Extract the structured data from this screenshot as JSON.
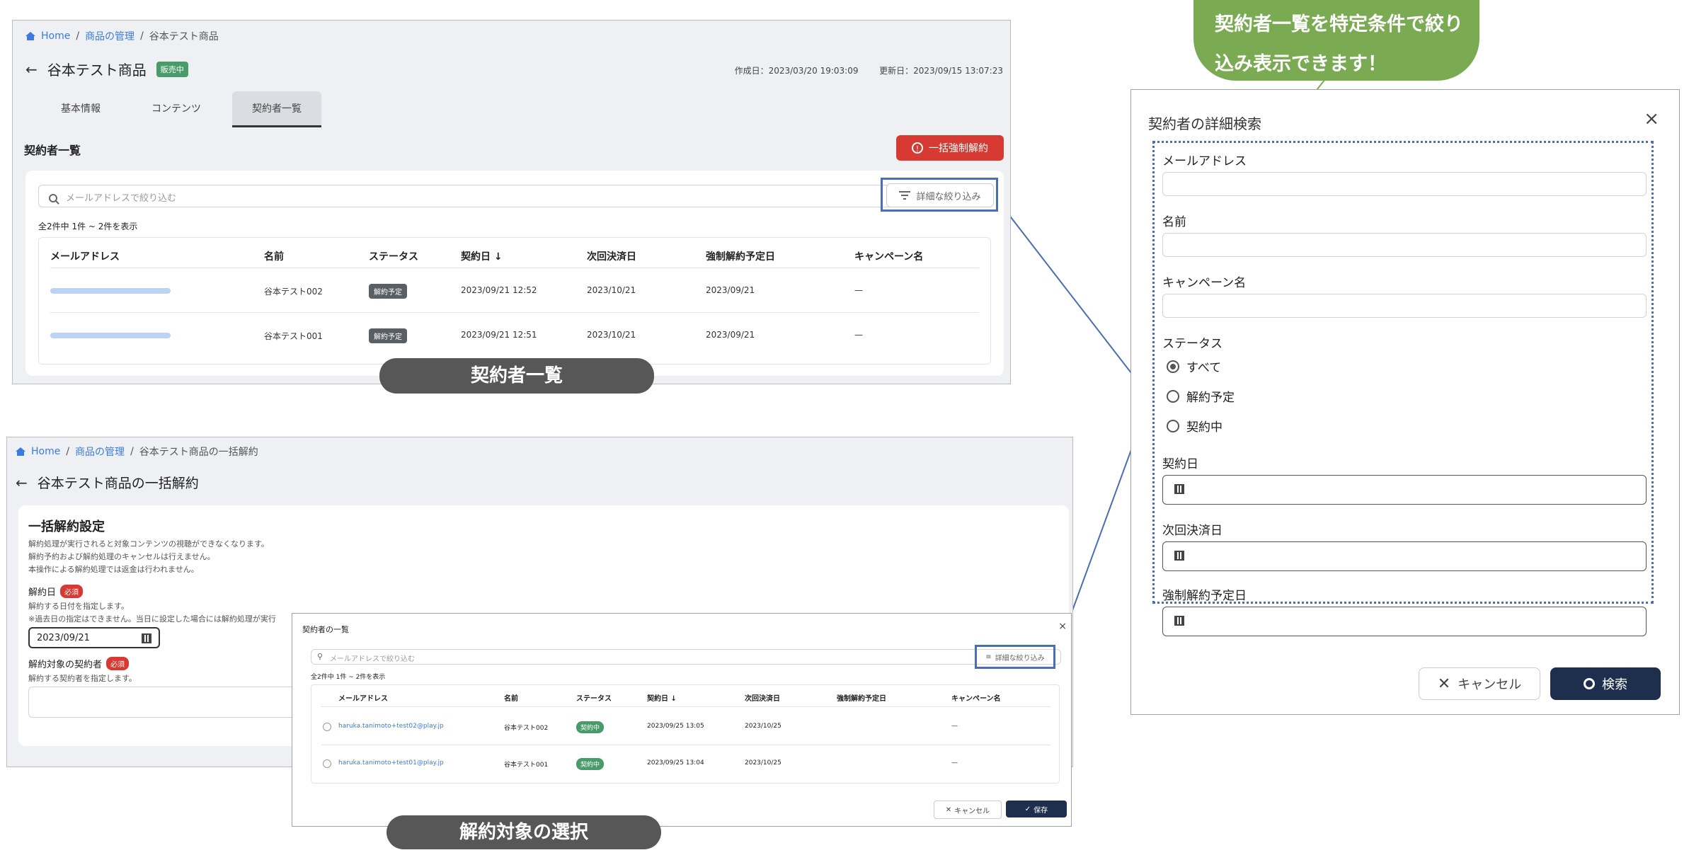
{
  "callout": {
    "line1": "契約者一覧を特定条件で絞り",
    "line2": "込み表示できます！"
  },
  "captions": {
    "top": "契約者一覧",
    "bottom": "解約対象の選択"
  },
  "top_screen": {
    "breadcrumb": {
      "home": "Home",
      "sep": "/",
      "level1": "商品の管理",
      "current": "谷本テスト商品"
    },
    "title": "谷本テスト商品",
    "status_badge": "販売中",
    "created": "作成日：2023/03/20 19:03:09",
    "updated": "更新日：2023/09/15 13:07:23",
    "tabs": [
      "基本情報",
      "コンテンツ",
      "契約者一覧"
    ],
    "section_title": "契約者一覧",
    "bulk_button": "一括強制解約",
    "search_placeholder": "メールアドレスで絞り込む",
    "filter_button": "詳細な絞り込み",
    "count_text": "全2件中 1件 ~ 2件を表示",
    "columns": [
      "メールアドレス",
      "名前",
      "ステータス",
      "契約日 ↓",
      "次回決済日",
      "強制解約予定日",
      "キャンペーン名"
    ],
    "rows": [
      {
        "name": "谷本テスト002",
        "status": "解約予定",
        "contract": "2023/09/21 12:52",
        "next": "2023/10/21",
        "forced": "2023/09/21",
        "campaign": "—"
      },
      {
        "name": "谷本テスト001",
        "status": "解約予定",
        "contract": "2023/09/21 12:51",
        "next": "2023/10/21",
        "forced": "2023/09/21",
        "campaign": "—"
      }
    ]
  },
  "bottom_screen": {
    "breadcrumb": {
      "home": "Home",
      "sep": "/",
      "level1": "商品の管理",
      "current": "谷本テスト商品の一括解約"
    },
    "title": "谷本テスト商品の一括解約",
    "section_title": "一括解約設定",
    "desc": [
      "解約処理が実行されると対象コンテンツの視聴ができなくなります。",
      "解約予約および解約処理のキャンセルは行えません。",
      "本操作による解約処理では返金は行われません。"
    ],
    "date_label": "解約日",
    "required": "必須",
    "date_help1": "解約する日付を指定します。",
    "date_help2": "※過去日の指定はできません。当日に設定した場合には解約処理が実行",
    "date_value": "2023/09/21",
    "target_label": "解約対象の契約者",
    "target_help": "解約する契約者を指定します。"
  },
  "select_dialog": {
    "title": "契約者の一覧",
    "close": "×",
    "search_placeholder": "メールアドレスで絞り込む",
    "filter_button": "詳細な絞り込み",
    "count_text": "全2件中 1件 ~ 2件を表示",
    "columns": [
      "メールアドレス",
      "名前",
      "ステータス",
      "契約日 ↓",
      "次回決済日",
      "強制解約予定日",
      "キャンペーン名"
    ],
    "rows": [
      {
        "email": "haruka.tanimoto+test02@play.jp",
        "name": "谷本テスト002",
        "status": "契約中",
        "contract": "2023/09/25 13:05",
        "next": "2023/10/25",
        "campaign": "—"
      },
      {
        "email": "haruka.tanimoto+test01@play.jp",
        "name": "谷本テスト001",
        "status": "契約中",
        "contract": "2023/09/25 13:04",
        "next": "2023/10/25",
        "campaign": "—"
      }
    ],
    "cancel": "キャンセル",
    "save": "保存"
  },
  "search_dialog": {
    "title": "契約者の詳細検索",
    "close": "×",
    "fields": {
      "email": "メールアドレス",
      "name": "名前",
      "campaign": "キャンペーン名",
      "status": "ステータス",
      "contract_date": "契約日",
      "next_date": "次回決済日",
      "forced_date": "強制解約予定日"
    },
    "status_options": [
      "すべて",
      "解約予定",
      "契約中"
    ],
    "cancel": "キャンセル",
    "search": "検索"
  }
}
